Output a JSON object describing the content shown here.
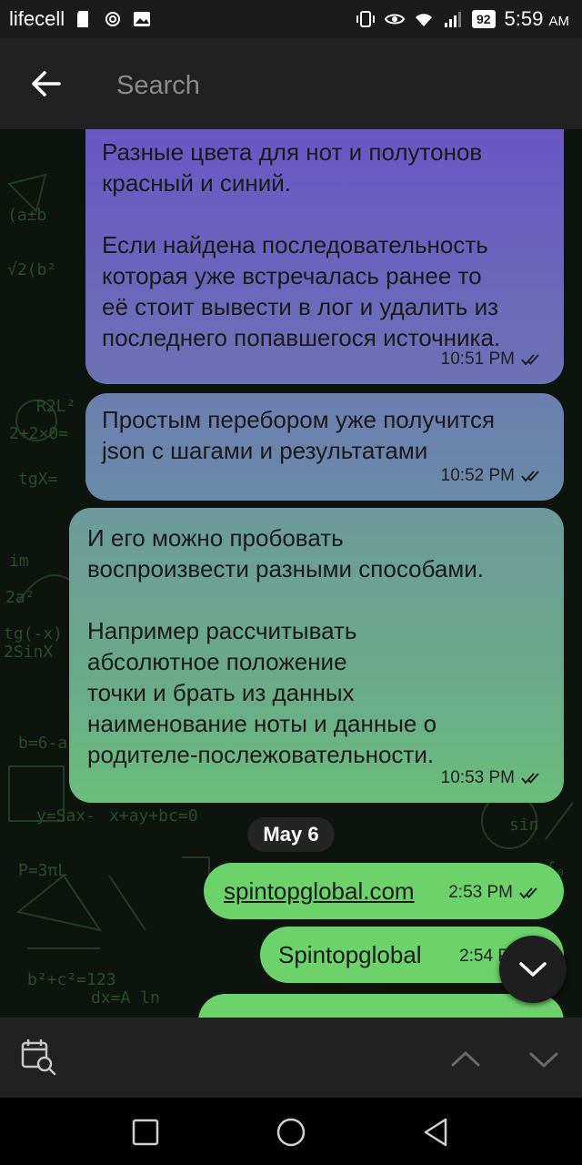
{
  "status_bar": {
    "carrier": "lifecell",
    "battery": "92",
    "time": "5:59",
    "ampm": "AM"
  },
  "toolbar": {
    "search_placeholder": "Search"
  },
  "messages": [
    {
      "text": "Разные цвета для нот и полутонов\nкрасный и синий.\n\nЕсли найдена последовательность\nкоторая уже встречалась ранее то\nеё стоит вывести в лог и удалить из\nпоследнего попавшегося источника.",
      "time": "10:51 PM"
    },
    {
      "text": "Простым перебором уже получится\njson с шагами и результатами",
      "time": "10:52 PM"
    },
    {
      "text": "И его можно пробовать\nвоспроизвести разными способами.\n\nНапример рассчитывать\nабсолютное положение\nточки и брать из данных\nнаименование ноты и данные о\nродителе-послежовательности.",
      "time": "10:53 PM"
    },
    {
      "text": "spintopglobal.com",
      "time": "2:53 PM"
    },
    {
      "text": "Spintopglobal",
      "time": "2:54 P"
    }
  ],
  "date_separator": "May 6",
  "colors": {
    "toolbar_bg": "#212121",
    "bubble_green": "#6cd26a",
    "bubble_purple": "#6a55c6"
  }
}
